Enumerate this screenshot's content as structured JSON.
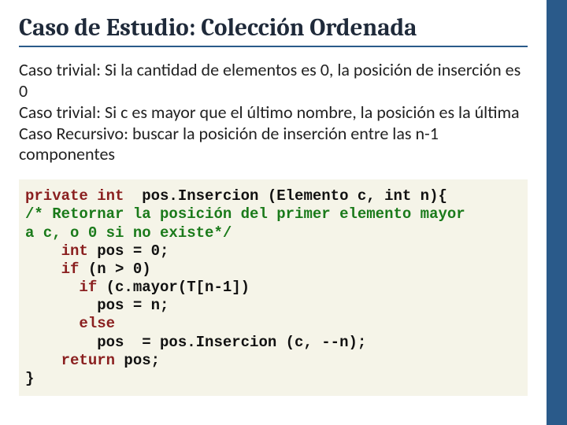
{
  "title": "Caso de Estudio: Colección Ordenada",
  "body": {
    "p1": "Caso trivial: Si la cantidad de elementos es 0, la posición de inserción es 0",
    "p2": "Caso trivial: Si c es mayor que el último nombre, la posición es la última",
    "p3": "Caso Recursivo: buscar la posición de inserción entre las n-1 componentes"
  },
  "code": {
    "l1a": "private int",
    "l1b": "  pos.Insercion (Elemento c, int n){",
    "l2": "/* Retornar la posición del primer elemento mayor",
    "l3": "a c, o 0 si no existe*/",
    "l4a": "    int",
    "l4b": " pos = 0;",
    "l5a": "    if",
    "l5b": " (n > 0)",
    "l6a": "      if",
    "l6b": " (c.mayor(T[n-1])",
    "l7": "        pos = n;",
    "l8": "      else",
    "l9": "        pos  = pos.Insercion (c, --n);",
    "l10a": "    return",
    "l10b": " pos;",
    "l11": "}"
  }
}
